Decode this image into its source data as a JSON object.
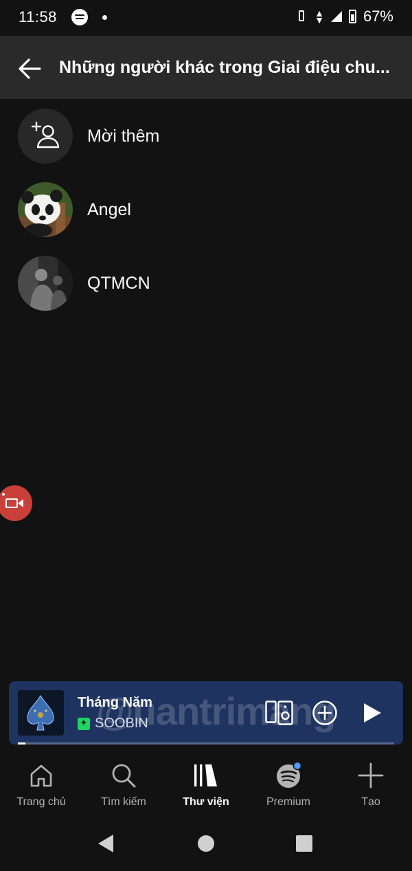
{
  "status_bar": {
    "time": "11:58",
    "battery": "67%"
  },
  "header": {
    "title": "Những người khác trong Giai điệu chu..."
  },
  "people": [
    {
      "label": "Mời thêm",
      "type": "invite",
      "icon": "add-person-icon"
    },
    {
      "label": "Angel",
      "type": "user",
      "avatar": "panda"
    },
    {
      "label": "QTMCN",
      "type": "user",
      "avatar": "grayscale-photo"
    }
  ],
  "mini_player": {
    "title": "Tháng Năm",
    "artist": "SOOBIN",
    "progress": 0.02
  },
  "watermark": "@uantrimang",
  "tabs": [
    {
      "label": "Trang chủ",
      "icon": "home-icon",
      "active": false
    },
    {
      "label": "Tìm kiếm",
      "icon": "search-icon",
      "active": false
    },
    {
      "label": "Thư viện",
      "icon": "library-icon",
      "active": true
    },
    {
      "label": "Premium",
      "icon": "spotify-icon",
      "active": false
    },
    {
      "label": "Tạo",
      "icon": "plus-icon",
      "active": false
    }
  ],
  "colors": {
    "background": "#121212",
    "header": "#2a2a2a",
    "mini_player": "#1e3360",
    "accent_green": "#1ed760",
    "record_button": "#c9403b"
  }
}
